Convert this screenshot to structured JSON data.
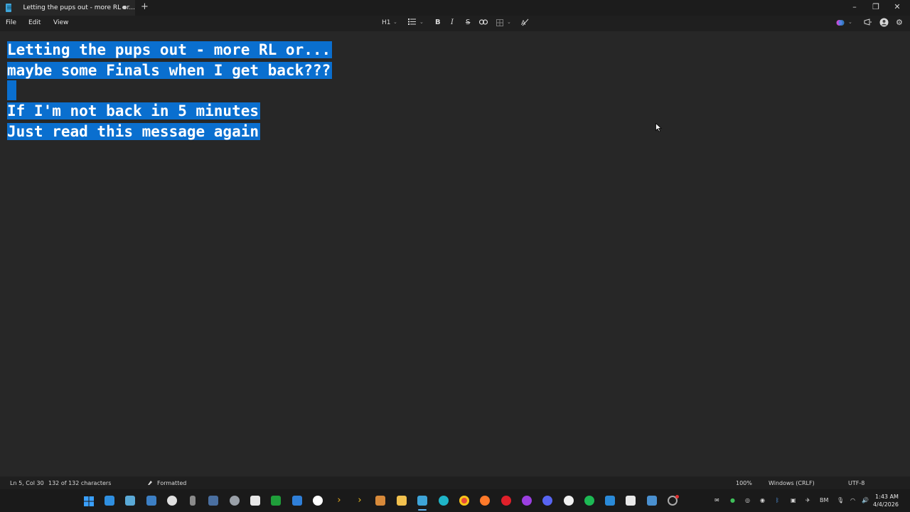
{
  "window": {
    "tab_title": "Letting the pups out - more RL or...",
    "new_tab_symbol": "+",
    "minimize_symbol": "–",
    "maximize_symbol": "❐",
    "close_symbol": "✕"
  },
  "menu": {
    "file": "File",
    "edit": "Edit",
    "view": "View"
  },
  "toolbar": {
    "heading": "H1",
    "list_icon": "list-icon",
    "bold": "B",
    "italic": "I",
    "strikethrough": "S",
    "link_icon": "link-icon",
    "table_icon": "table-icon",
    "clear_format_icon": "clear-format-icon"
  },
  "document": {
    "line1": "Letting the pups out - more RL or...",
    "line2": "maybe some Finals when I get back???",
    "line3": "",
    "line4": "If I'm not back in 5 minutes",
    "line5": "Just read this message again"
  },
  "status": {
    "position": "Ln 5, Col 30",
    "characters": "132 of 132 characters",
    "mode": "Formatted",
    "zoom": "100%",
    "line_endings": "Windows (CRLF)",
    "encoding": "UTF-8"
  },
  "clock": {
    "time": "1:43 AM",
    "date": "4/4/2026"
  },
  "tray": {
    "bm_label": "BM"
  },
  "colors": {
    "selection": "#0a6fcf",
    "background": "#272727",
    "chrome": "#1f1f1f"
  }
}
